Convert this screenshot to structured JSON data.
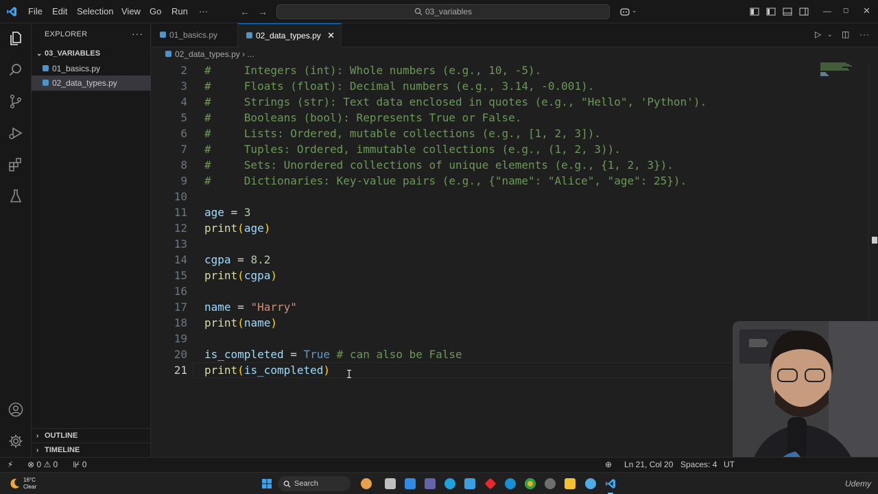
{
  "titlebar": {
    "menu": [
      "File",
      "Edit",
      "Selection",
      "View",
      "Go",
      "Run",
      "···"
    ],
    "command_center": "03_variables"
  },
  "explorer": {
    "header": "EXPLORER",
    "more": "···",
    "folder": "03_VARIABLES",
    "files": [
      "01_basics.py",
      "02_data_types.py"
    ],
    "selected_file": "02_data_types.py",
    "outline": "OUTLINE",
    "timeline": "TIMELINE"
  },
  "tabs": [
    {
      "label": "01_basics.py",
      "active": false
    },
    {
      "label": "02_data_types.py",
      "active": true
    }
  ],
  "breadcrumb": [
    "02_data_types.py",
    "..."
  ],
  "editor": {
    "current_line": 21,
    "lines": [
      {
        "n": "2",
        "tokens": [
          [
            "c-cmt",
            "#     Integers (int): Whole numbers (e.g., 10, -5)."
          ]
        ]
      },
      {
        "n": "3",
        "tokens": [
          [
            "c-cmt",
            "#     Floats (float): Decimal numbers (e.g., 3.14, -0.001)."
          ]
        ]
      },
      {
        "n": "4",
        "tokens": [
          [
            "c-cmt",
            "#     Strings (str): Text data enclosed in quotes (e.g., \"Hello\", 'Python')."
          ]
        ]
      },
      {
        "n": "5",
        "tokens": [
          [
            "c-cmt",
            "#     Booleans (bool): Represents True or False."
          ]
        ]
      },
      {
        "n": "6",
        "tokens": [
          [
            "c-cmt",
            "#     Lists: Ordered, mutable collections (e.g., [1, 2, 3])."
          ]
        ]
      },
      {
        "n": "7",
        "tokens": [
          [
            "c-cmt",
            "#     Tuples: Ordered, immutable collections (e.g., (1, 2, 3))."
          ]
        ]
      },
      {
        "n": "8",
        "tokens": [
          [
            "c-cmt",
            "#     Sets: Unordered collections of unique elements (e.g., {1, 2, 3})."
          ]
        ]
      },
      {
        "n": "9",
        "tokens": [
          [
            "c-cmt",
            "#     Dictionaries: Key-value pairs (e.g., {\"name\": \"Alice\", \"age\": 25})."
          ]
        ]
      },
      {
        "n": "10",
        "tokens": []
      },
      {
        "n": "11",
        "tokens": [
          [
            "c-var",
            "age"
          ],
          [
            "c-op",
            " = "
          ],
          [
            "c-num",
            "3"
          ]
        ]
      },
      {
        "n": "12",
        "tokens": [
          [
            "c-fn",
            "print"
          ],
          [
            "c-par",
            "("
          ],
          [
            "c-var",
            "age"
          ],
          [
            "c-par",
            ")"
          ]
        ]
      },
      {
        "n": "13",
        "tokens": []
      },
      {
        "n": "14",
        "tokens": [
          [
            "c-var",
            "cgpa"
          ],
          [
            "c-op",
            " = "
          ],
          [
            "c-num",
            "8.2"
          ]
        ]
      },
      {
        "n": "15",
        "tokens": [
          [
            "c-fn",
            "print"
          ],
          [
            "c-par",
            "("
          ],
          [
            "c-var",
            "cgpa"
          ],
          [
            "c-par",
            ")"
          ]
        ]
      },
      {
        "n": "16",
        "tokens": []
      },
      {
        "n": "17",
        "tokens": [
          [
            "c-var",
            "name"
          ],
          [
            "c-op",
            " = "
          ],
          [
            "c-str",
            "\"Harry\""
          ]
        ]
      },
      {
        "n": "18",
        "tokens": [
          [
            "c-fn",
            "print"
          ],
          [
            "c-par",
            "("
          ],
          [
            "c-var",
            "name"
          ],
          [
            "c-par",
            ")"
          ]
        ]
      },
      {
        "n": "19",
        "tokens": []
      },
      {
        "n": "20",
        "tokens": [
          [
            "c-var",
            "is_completed"
          ],
          [
            "c-op",
            " = "
          ],
          [
            "c-kw",
            "True"
          ],
          [
            "c-cmt",
            " # can also be False"
          ]
        ]
      },
      {
        "n": "21",
        "tokens": [
          [
            "c-fn",
            "print"
          ],
          [
            "c-par",
            "("
          ],
          [
            "c-var",
            "is_completed"
          ],
          [
            "c-par",
            ")"
          ]
        ]
      }
    ]
  },
  "statusbar": {
    "errors": "0",
    "warnings": "0",
    "ports": "0",
    "position": "Ln 21, Col 20",
    "spaces": "Spaces: 4",
    "encoding": "UT"
  },
  "taskbar": {
    "weather_temp": "16°C",
    "weather_desc": "Clear",
    "search": "Search",
    "watermark": "Udemy"
  },
  "colors": {
    "accent": "#0078d4",
    "comment": "#6a9955",
    "variable": "#9cdcfe",
    "number": "#b5cea8",
    "string": "#ce9178",
    "function": "#dcdcaa",
    "keyword": "#569cd6"
  }
}
